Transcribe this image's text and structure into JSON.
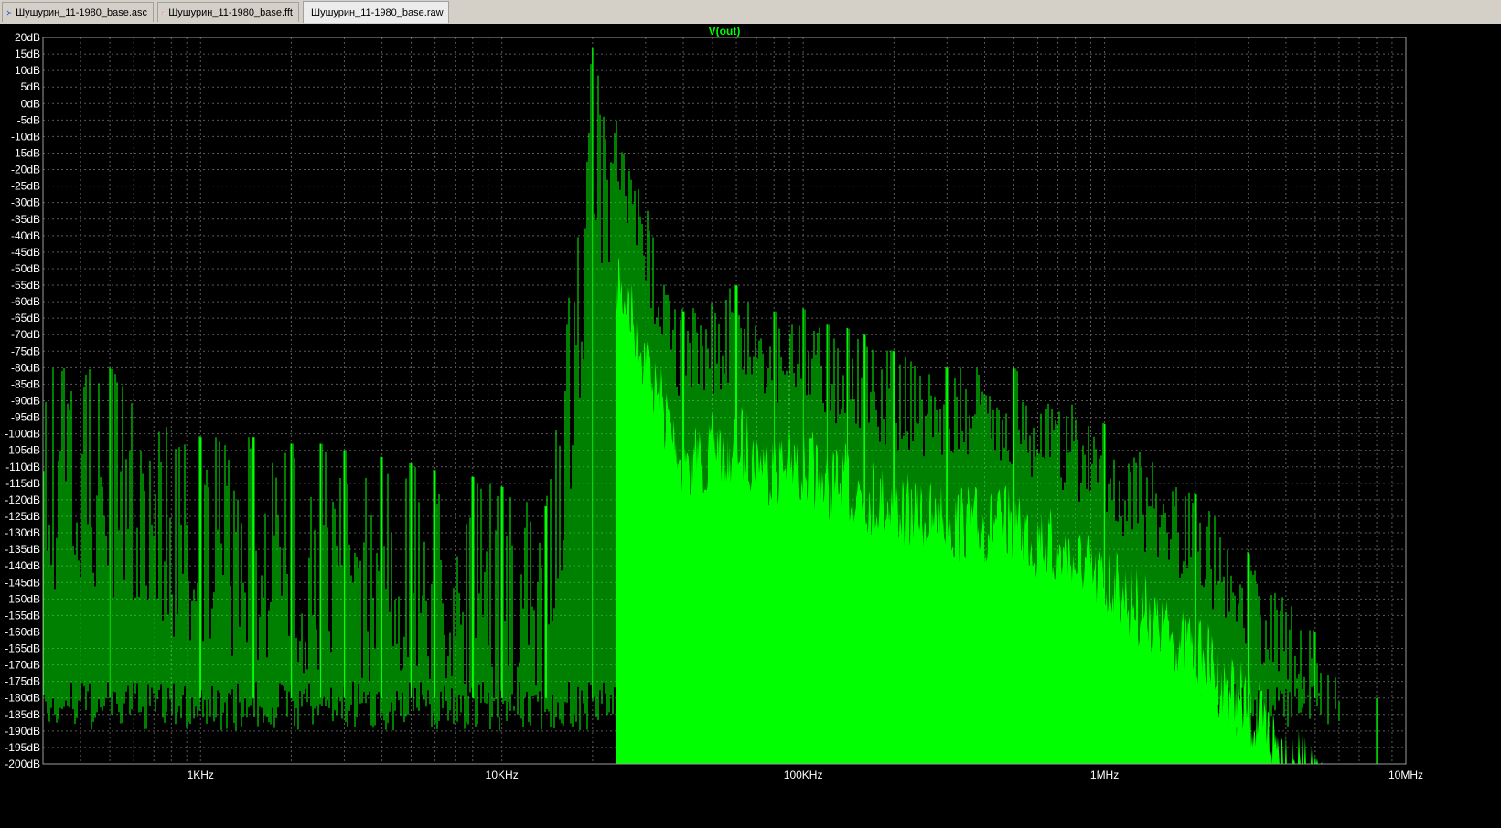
{
  "tabs": [
    {
      "label": "Шушурин_11-1980_base.asc",
      "icon": "schematic-icon"
    },
    {
      "label": "Шушурин_11-1980_base.fft",
      "icon": "waveform-icon"
    },
    {
      "label": "Шушурин_11-1980_base.raw",
      "icon": "waveform-icon"
    }
  ],
  "colors": {
    "trace": "#00ff00",
    "grid": "#5a5a5a",
    "axis_text": "#ffffff",
    "background": "#000000",
    "title": "#00ff00"
  },
  "chart_data": {
    "type": "line",
    "title": "V(out)",
    "x_scale": "log",
    "xlim": [
      300,
      10000000
    ],
    "ylim": [
      -200,
      20
    ],
    "grid": true,
    "x_ticks": [
      "1KHz",
      "10KHz",
      "100KHz",
      "1MHz",
      "10MHz"
    ],
    "y_ticks": [
      "20dB",
      "15dB",
      "10dB",
      "5dB",
      "0dB",
      "-5dB",
      "-10dB",
      "-15dB",
      "-20dB",
      "-25dB",
      "-30dB",
      "-35dB",
      "-40dB",
      "-45dB",
      "-50dB",
      "-55dB",
      "-60dB",
      "-65dB",
      "-70dB",
      "-75dB",
      "-80dB",
      "-85dB",
      "-90dB",
      "-95dB",
      "-100dB",
      "-105dB",
      "-110dB",
      "-115dB",
      "-120dB",
      "-125dB",
      "-130dB",
      "-135dB",
      "-140dB",
      "-145dB",
      "-150dB",
      "-155dB",
      "-160dB",
      "-165dB",
      "-170dB",
      "-175dB",
      "-180dB",
      "-185dB",
      "-190dB",
      "-195dB",
      "-200dB"
    ],
    "series": [
      {
        "name": "V(out)",
        "peaks": [
          [
            500,
            -80
          ],
          [
            1000,
            -101
          ],
          [
            1500,
            -101
          ],
          [
            2000,
            -103
          ],
          [
            2500,
            -103
          ],
          [
            3000,
            -105
          ],
          [
            4000,
            -107
          ],
          [
            5000,
            -109
          ],
          [
            6000,
            -111
          ],
          [
            8000,
            -113
          ],
          [
            10000,
            -116
          ],
          [
            14000,
            -122
          ],
          [
            20000,
            17
          ],
          [
            40000,
            -63
          ],
          [
            60000,
            -55
          ],
          [
            80000,
            -63
          ],
          [
            100000,
            -62
          ],
          [
            120000,
            -67
          ],
          [
            140000,
            -68
          ],
          [
            160000,
            -70
          ],
          [
            200000,
            -75
          ],
          [
            300000,
            -80
          ],
          [
            500000,
            -80
          ],
          [
            1000000,
            -97
          ],
          [
            2000000,
            -118
          ],
          [
            3000000,
            -136
          ],
          [
            5000000,
            -160
          ],
          [
            8000000,
            -200
          ]
        ]
      }
    ]
  }
}
